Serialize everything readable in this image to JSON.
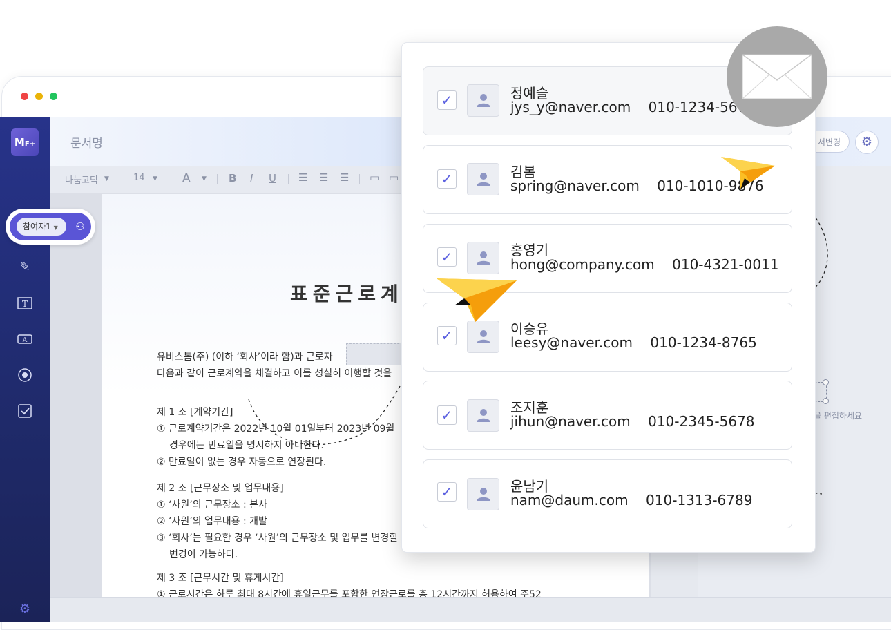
{
  "header": {
    "doc_name": "문서명",
    "change_button": "서변경"
  },
  "toolbar": {
    "font": "나눔고딕",
    "size": "14"
  },
  "sidebar": {
    "logo": "M",
    "logo_suffix": "F+",
    "participant": "참여자1"
  },
  "document": {
    "title": "표준근로계",
    "lines": [
      "유비스톰(주) (이하 ‘회사’이라 함)과 근로자",
      "다음과 같이 근로계약을 체결하고 이를 성실히 이행할 것을",
      "제 1 조 [계약기간]",
      "① 근로계약기간은 2022년 10월  01일부터 2023년 09월",
      "경우에는 만료일을 명시하지 아니한다.",
      "② 만료일이 없는 경우 자동으로 연장된다.",
      "제 2 조 [근무장소 및 업무내용]",
      "① ‘사원’의 근무장소 : 본사",
      "② ‘사원’의 업무내용 : 개발",
      "③ ‘회사’는 필요한 경우 ‘사원’의 근무장소 및 업무를 변경할",
      "변경이 가능하다.",
      "제 3 조 [근무시간 및 휴게시간]",
      "① 근로시간은 하루 최대 8시간에 휴일근무를 포함한 연장근로를 총 12시간까지 허용하여 주52"
    ]
  },
  "right_panel": {
    "hint": "을 편집하세요"
  },
  "contacts": [
    {
      "name": "정예슬",
      "email": "jys_y@naver.com",
      "phone": "010-1234-5678",
      "checked": true
    },
    {
      "name": "김봄",
      "email": "spring@naver.com",
      "phone": "010-1010-9876",
      "checked": true
    },
    {
      "name": "홍영기",
      "email": "hong@company.com",
      "phone": "010-4321-0011",
      "checked": true
    },
    {
      "name": "이승유",
      "email": "leesy@naver.com",
      "phone": "010-1234-8765",
      "checked": true
    },
    {
      "name": "조지훈",
      "email": "jihun@naver.com",
      "phone": "010-2345-5678",
      "checked": true
    },
    {
      "name": "윤남기",
      "email": "nam@daum.com",
      "phone": "010-1313-6789",
      "checked": true
    }
  ],
  "colors": {
    "sidebar": "#27338a",
    "accent": "#5a5fe0",
    "plane": "#fbbf24"
  },
  "icons": [
    "pen-icon",
    "text-box-icon",
    "text-field-icon",
    "radio-icon",
    "checkbox-icon",
    "gear-icon",
    "add-user-icon",
    "envelope-icon",
    "paper-plane-icon"
  ]
}
